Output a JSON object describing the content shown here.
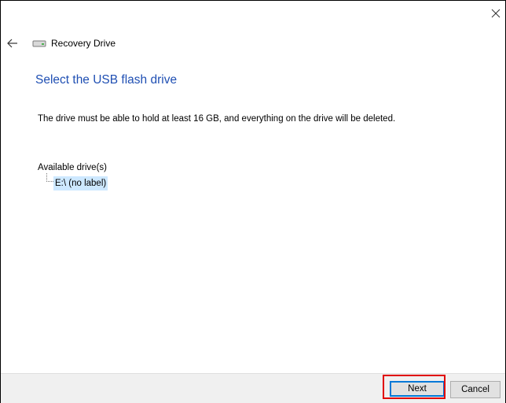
{
  "window": {
    "title": "Recovery Drive"
  },
  "page": {
    "heading": "Select the USB flash drive",
    "description": "The drive must be able to hold at least 16 GB, and everything on the drive will be deleted."
  },
  "drives": {
    "label": "Available drive(s)",
    "items": [
      {
        "label": "E:\\ (no label)",
        "selected": true
      }
    ]
  },
  "buttons": {
    "next": "Next",
    "cancel": "Cancel"
  },
  "icons": {
    "close": "close-icon",
    "back": "back-arrow-icon",
    "drive": "drive-icon"
  },
  "colors": {
    "heading": "#1f4fb3",
    "selection": "#cde8ff",
    "focus_border": "#0078d7",
    "annotation": "#e00000"
  }
}
